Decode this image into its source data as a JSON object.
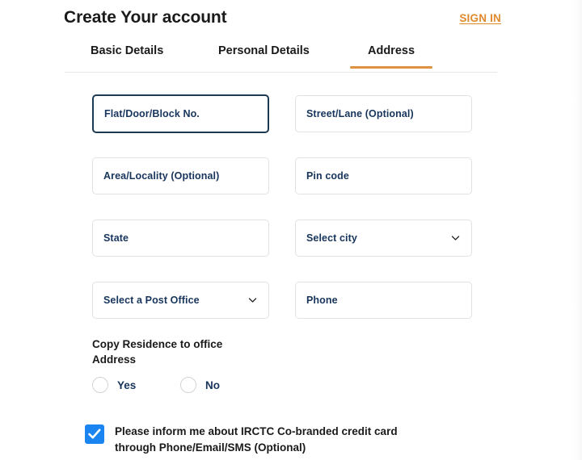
{
  "header": {
    "title": "Create Your account",
    "sign_in_label": "SIGN IN"
  },
  "tabs": {
    "items": [
      {
        "label": "Basic Details",
        "active": false
      },
      {
        "label": "Personal Details",
        "active": false
      },
      {
        "label": "Address",
        "active": true
      }
    ],
    "active_underline_color": "#e0913f"
  },
  "form": {
    "rows": [
      {
        "left": {
          "name": "flat-door-block-input",
          "placeholder": "Flat/Door/Block No.",
          "value": "",
          "type": "text",
          "focused": true
        },
        "right": {
          "name": "street-lane-input",
          "placeholder": "Street/Lane (Optional)",
          "value": "",
          "type": "text",
          "focused": false
        }
      },
      {
        "left": {
          "name": "area-locality-input",
          "placeholder": "Area/Locality (Optional)",
          "value": "",
          "type": "text",
          "focused": false
        },
        "right": {
          "name": "pin-code-input",
          "placeholder": "Pin code",
          "value": "",
          "type": "text",
          "focused": false
        }
      },
      {
        "left": {
          "name": "state-input",
          "placeholder": "State",
          "value": "",
          "type": "text",
          "focused": false
        },
        "right": {
          "name": "select-city-dropdown",
          "placeholder": "Select city",
          "value": "",
          "type": "select",
          "focused": false
        }
      },
      {
        "left": {
          "name": "select-post-office-dropdown",
          "placeholder": "Select a Post Office",
          "value": "",
          "type": "select",
          "focused": false
        },
        "right": {
          "name": "phone-input",
          "placeholder": "Phone",
          "value": "",
          "type": "text",
          "focused": false
        }
      }
    ],
    "focus_border_color": "#1c3a52",
    "placeholder_color": "#17355c"
  },
  "copy_residence": {
    "label": "Copy Residence to office Address",
    "options": [
      {
        "label": "Yes",
        "selected": false
      },
      {
        "label": "No",
        "selected": false
      }
    ]
  },
  "promo_checkbox": {
    "checked": true,
    "label": "Please inform me about IRCTC Co-branded credit card through Phone/Email/SMS (Optional)",
    "color": "#1a84f0"
  }
}
